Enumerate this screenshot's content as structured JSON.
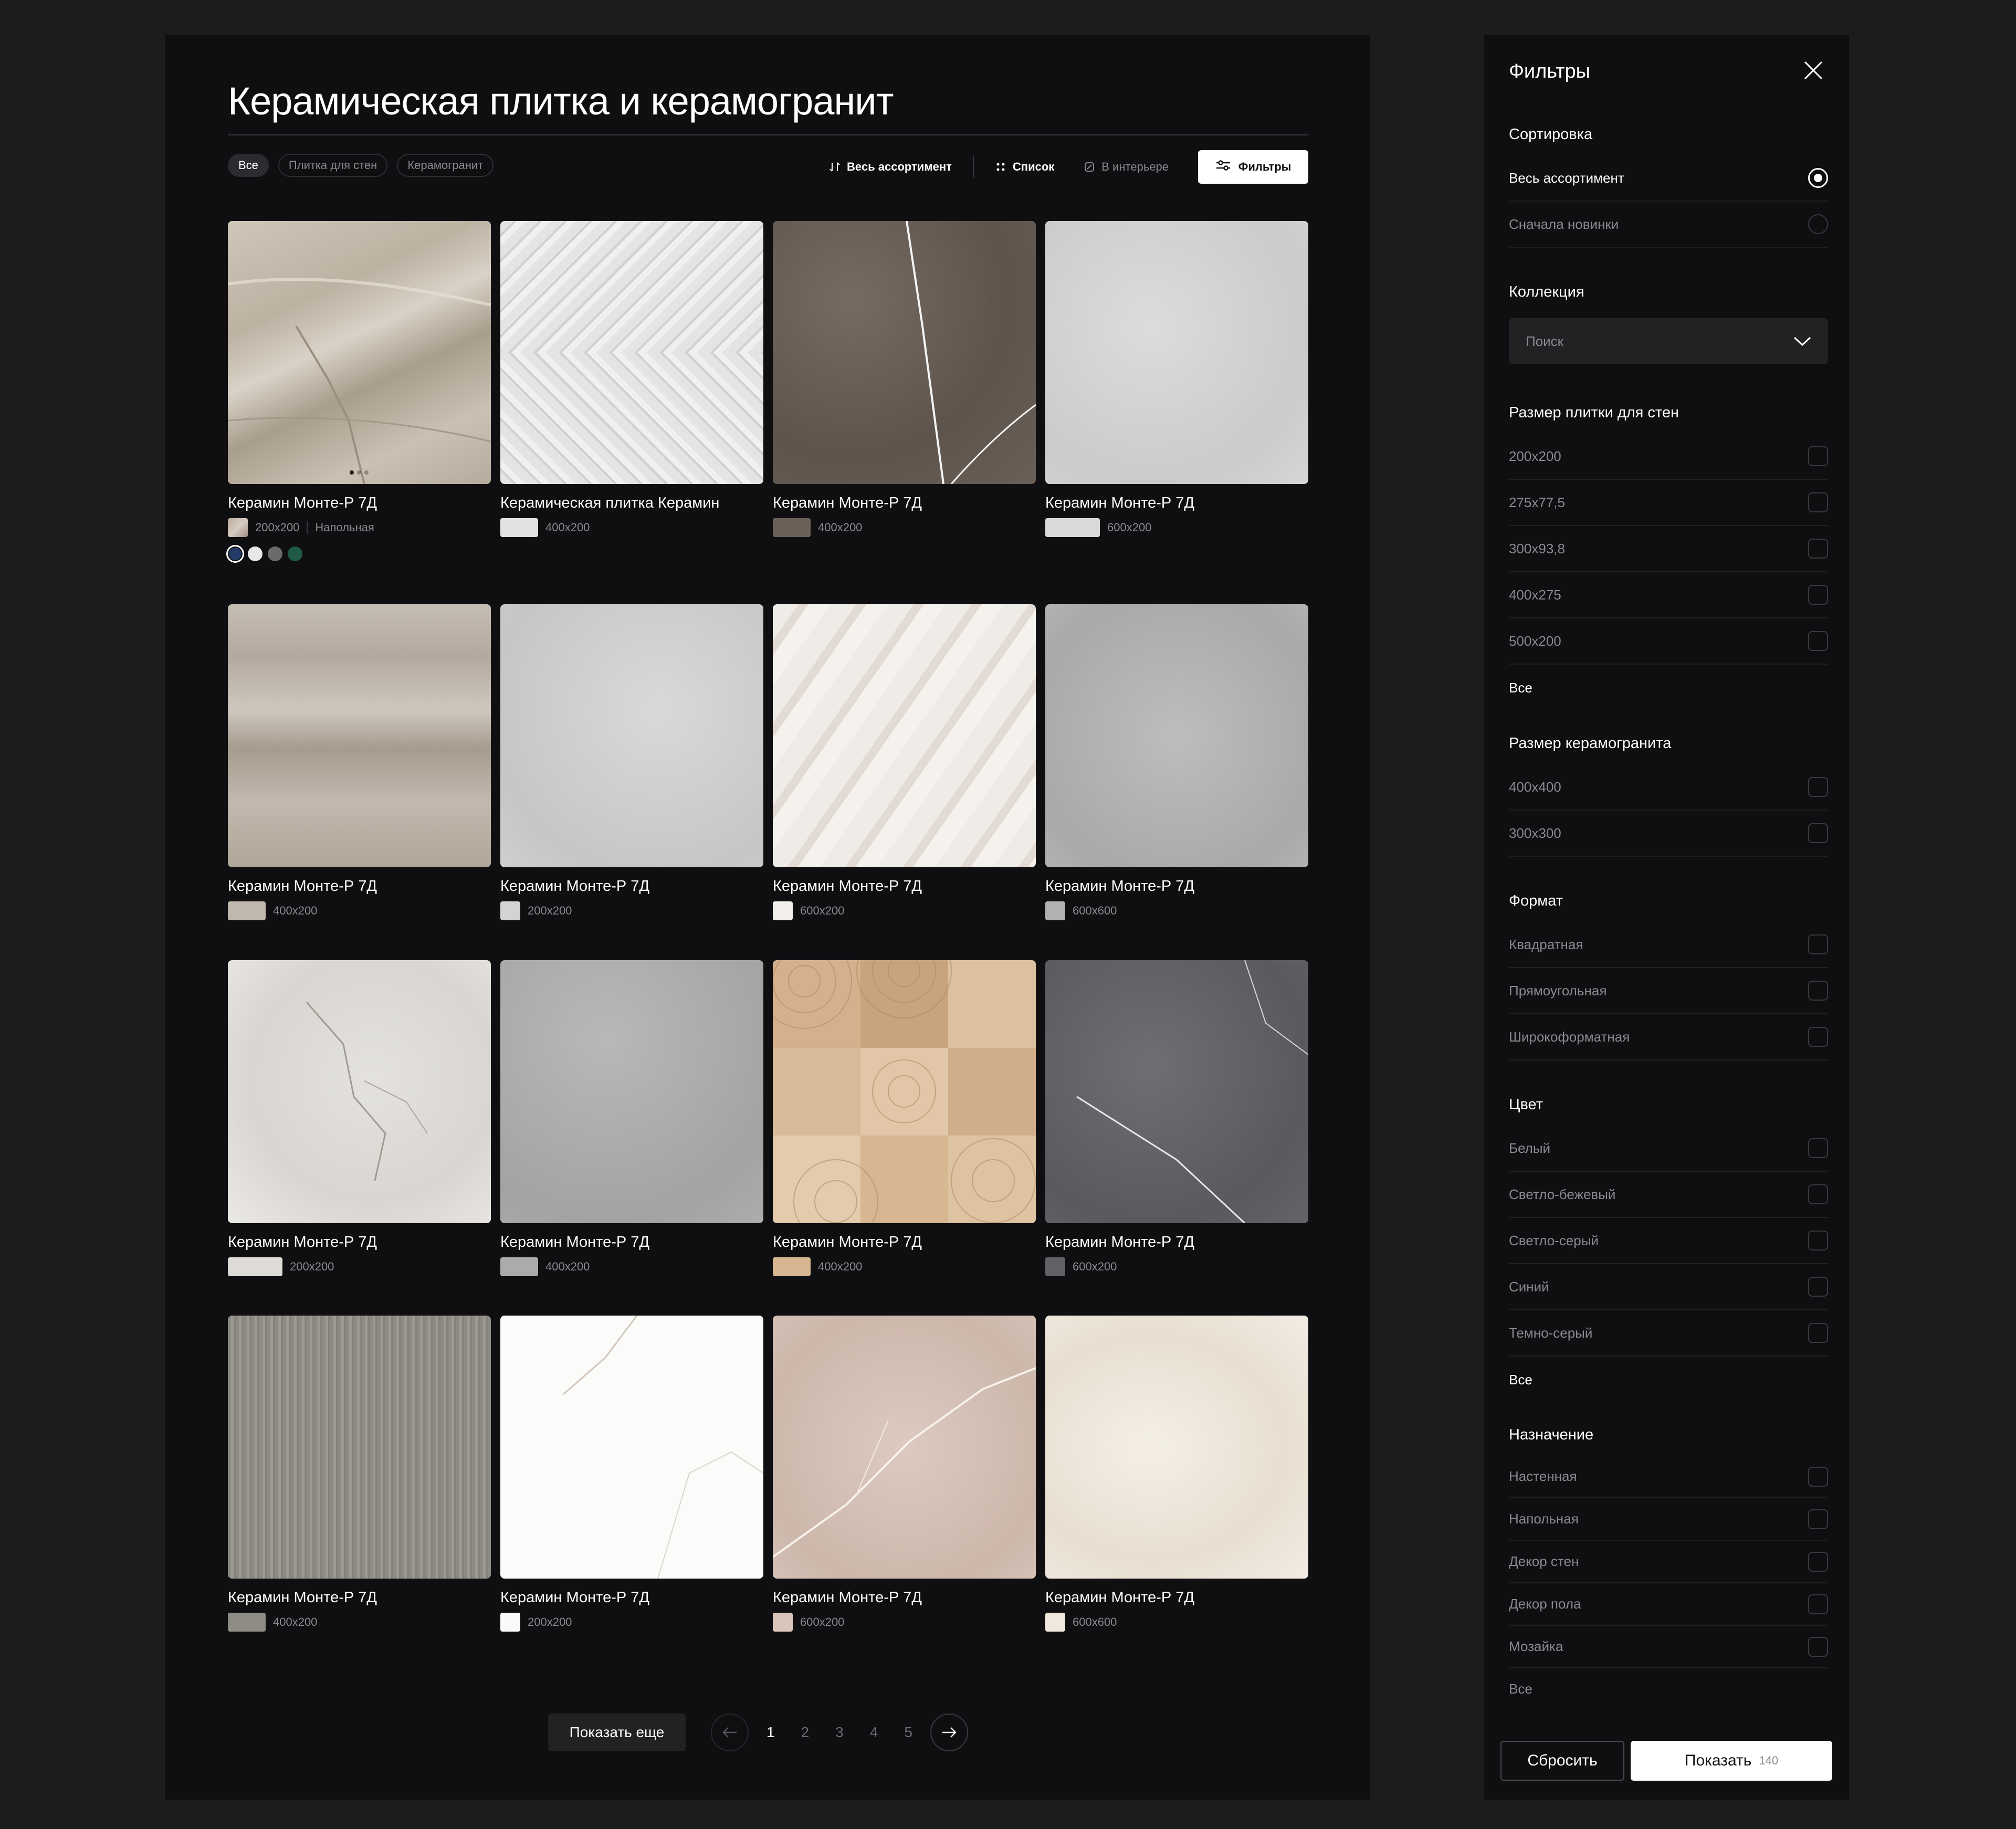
{
  "catalog": {
    "title": "Керамическая плитка и керамогранит",
    "chips": [
      "Все",
      "Плитка для стен",
      "Керамогранит"
    ],
    "toolbar": {
      "sort_label": "Весь ассортимент",
      "list_label": "Список",
      "interior_label": "В интерьере",
      "filters_label": "Фильтры"
    },
    "products": [
      {
        "title": "Керамин Монте-Р 7Д",
        "size": "200x200",
        "type": "Напольная",
        "colors": [
          "#233b66",
          "#e8e8e8",
          "#6b6b6b",
          "#1f5b45"
        ]
      },
      {
        "title": "Керамическая плитка Керамин",
        "size": "400x200"
      },
      {
        "title": "Керамин Монте-Р 7Д",
        "size": "400x200"
      },
      {
        "title": "Керамин Монте-Р 7Д",
        "size": "600x200"
      },
      {
        "title": "Керамин Монте-Р 7Д",
        "size": "400x200"
      },
      {
        "title": "Керамин Монте-Р 7Д",
        "size": "200x200"
      },
      {
        "title": "Керамин Монте-Р 7Д",
        "size": "600x200"
      },
      {
        "title": "Керамин Монте-Р 7Д",
        "size": "600x600"
      },
      {
        "title": "Керамин Монте-Р 7Д",
        "size": "200x200"
      },
      {
        "title": "Керамин Монте-Р 7Д",
        "size": "400x200"
      },
      {
        "title": "Керамин Монте-Р 7Д",
        "size": "400x200"
      },
      {
        "title": "Керамин Монте-Р 7Д",
        "size": "600x200"
      },
      {
        "title": "Керамин Монте-Р 7Д",
        "size": "400x200"
      },
      {
        "title": "Керамин Монте-Р 7Д",
        "size": "200x200"
      },
      {
        "title": "Керамин Монте-Р 7Д",
        "size": "600x200"
      },
      {
        "title": "Керамин Монте-Р 7Д",
        "size": "600x600"
      }
    ],
    "pagination": {
      "more_label": "Показать еще",
      "pages": [
        "1",
        "2",
        "3",
        "4",
        "5"
      ],
      "current": "1"
    }
  },
  "filters": {
    "title": "Фильтры",
    "sorting": {
      "title": "Сортировка",
      "options": [
        "Весь ассортимент",
        "Сначала новинки"
      ],
      "selected": "Весь ассортимент"
    },
    "collection": {
      "title": "Коллекция",
      "placeholder": "Поиск"
    },
    "wall_size": {
      "title": "Размер плитки для стен",
      "options": [
        "200x200",
        "275x77,5",
        "300x93,8",
        "400x275",
        "500x200"
      ],
      "all": "Все"
    },
    "porcelain_size": {
      "title": "Размер керамогранита",
      "options": [
        "400x400",
        "300x300"
      ]
    },
    "format": {
      "title": "Формат",
      "options": [
        "Квадратная",
        "Прямоугольная",
        "Широкоформатная"
      ]
    },
    "color": {
      "title": "Цвет",
      "options": [
        "Белый",
        "Светло-бежевый",
        "Светло-серый",
        "Синий",
        "Темно-серый"
      ],
      "all": "Все"
    },
    "purpose": {
      "title": "Назначение",
      "options": [
        "Настенная",
        "Напольная",
        "Декор стен",
        "Декор пола",
        "Мозайка"
      ],
      "all": "Все"
    },
    "reset_label": "Сбросить",
    "show_label": "Показать",
    "count": "140"
  }
}
